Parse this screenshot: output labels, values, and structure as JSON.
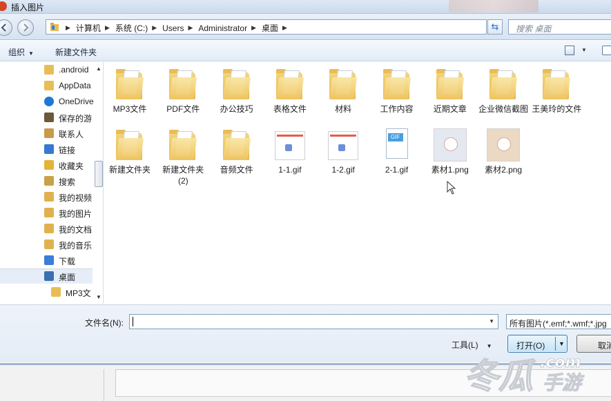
{
  "window": {
    "title": "插入图片"
  },
  "address": {
    "crumbs": [
      "计算机",
      "系统 (C:)",
      "Users",
      "Administrator",
      "桌面"
    ],
    "search_placeholder": "搜索 桌面"
  },
  "toolbar": {
    "organize": "组织",
    "new_folder": "新建文件夹"
  },
  "nav": {
    "items": [
      {
        "label": ".android",
        "icon": "folder-icon"
      },
      {
        "label": "AppData",
        "icon": "folder-icon"
      },
      {
        "label": "OneDrive",
        "icon": "cloud-icon"
      },
      {
        "label": "保存的游",
        "icon": "saved-games-icon"
      },
      {
        "label": "联系人",
        "icon": "contacts-icon"
      },
      {
        "label": "链接",
        "icon": "links-icon"
      },
      {
        "label": "收藏夹",
        "icon": "favorites-icon"
      },
      {
        "label": "搜索",
        "icon": "search-folder-icon"
      },
      {
        "label": "我的视频",
        "icon": "videos-icon"
      },
      {
        "label": "我的图片",
        "icon": "pictures-icon"
      },
      {
        "label": "我的文档",
        "icon": "documents-icon"
      },
      {
        "label": "我的音乐",
        "icon": "music-icon"
      },
      {
        "label": "下载",
        "icon": "downloads-icon"
      },
      {
        "label": "桌面",
        "icon": "desktop-icon"
      },
      {
        "label": "MP3文",
        "icon": "folder-icon"
      }
    ]
  },
  "files": [
    {
      "label": "MP3文件",
      "kind": "folder"
    },
    {
      "label": "PDF文件",
      "kind": "folder"
    },
    {
      "label": "办公技巧",
      "kind": "folder"
    },
    {
      "label": "表格文件",
      "kind": "folder"
    },
    {
      "label": "材料",
      "kind": "folder"
    },
    {
      "label": "工作内容",
      "kind": "folder"
    },
    {
      "label": "近期文章",
      "kind": "folder"
    },
    {
      "label": "企业微信截图",
      "kind": "folder"
    },
    {
      "label": "王美玲的文件",
      "kind": "folder"
    },
    {
      "label": "新建文件夹",
      "kind": "folder"
    },
    {
      "label": "新建文件夹 (2)",
      "kind": "folder"
    },
    {
      "label": "音频文件",
      "kind": "folder"
    },
    {
      "label": "1-1.gif",
      "kind": "gif-thumb"
    },
    {
      "label": "1-2.gif",
      "kind": "gif-thumb"
    },
    {
      "label": "2-1.gif",
      "kind": "gif-icon"
    },
    {
      "label": "素材1.png",
      "kind": "png"
    },
    {
      "label": "素材2.png",
      "kind": "png"
    }
  ],
  "gif_badge": "GIF",
  "bottom": {
    "filename_label": "文件名(N):",
    "filename_value": "",
    "filter": "所有图片(*.emf;*.wmf;*.jpg",
    "tools": "工具(L)",
    "open": "打开(O)",
    "cancel": "取消"
  },
  "watermark": {
    "text1": "冬瓜",
    "text2": ".com",
    "text3": "手游"
  },
  "colors": {
    "accent": "#3c7fb1",
    "folder": "#efc560",
    "gif_band": "#4a9ee0"
  }
}
